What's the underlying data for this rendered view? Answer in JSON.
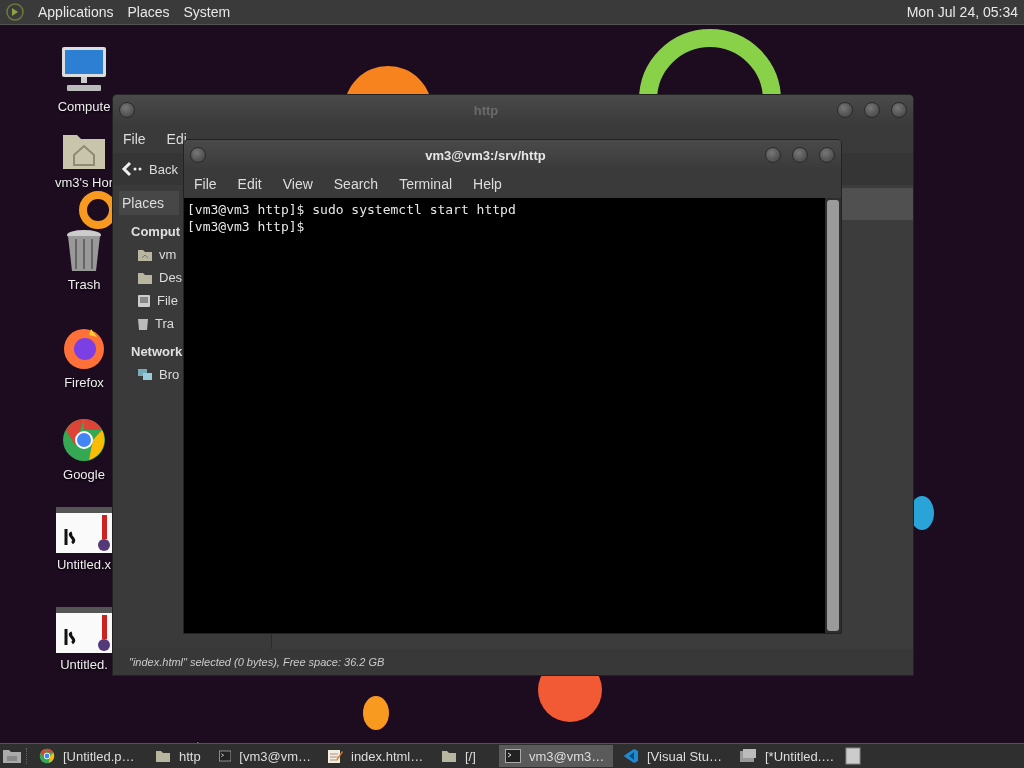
{
  "top_panel": {
    "menus": [
      "Applications",
      "Places",
      "System"
    ],
    "clock": "Mon Jul 24, 05:34"
  },
  "desktop_icons": [
    {
      "label": "Compute",
      "kind": "computer"
    },
    {
      "label": "vm3's Hor",
      "kind": "home"
    },
    {
      "label": "Trash",
      "kind": "trash"
    },
    {
      "label": "Firefox",
      "kind": "firefox"
    },
    {
      "label": "Google",
      "kind": "chrome"
    },
    {
      "label": "Untitled.x",
      "kind": "image"
    },
    {
      "label": "Untitled.",
      "kind": "image"
    }
  ],
  "file_manager": {
    "title": "http",
    "menu": [
      "File",
      "Edi"
    ],
    "back": "Back",
    "sidebar": {
      "header": "Places",
      "sections": [
        {
          "title": "Comput",
          "items": [
            {
              "label": "vm",
              "kind": "home"
            },
            {
              "label": "Des",
              "kind": "desktop"
            },
            {
              "label": "File",
              "kind": "drive"
            },
            {
              "label": "Tra",
              "kind": "trash"
            }
          ]
        },
        {
          "title": "Network",
          "items": [
            {
              "label": "Bro",
              "kind": "network"
            }
          ]
        }
      ]
    },
    "status": "\"index.html\" selected (0 bytes), Free space: 36.2 GB"
  },
  "terminal": {
    "title": "vm3@vm3:/srv/http",
    "menu": [
      "File",
      "Edit",
      "View",
      "Search",
      "Terminal",
      "Help"
    ],
    "lines": [
      "[vm3@vm3 http]$ sudo systemctl start httpd",
      "[vm3@vm3 http]$"
    ]
  },
  "taskbar": {
    "tasks": [
      {
        "label": "[Untitled.p…",
        "kind": "chrome",
        "selected": false
      },
      {
        "label": "http",
        "kind": "folder",
        "selected": false
      },
      {
        "label": "[vm3@vm…",
        "kind": "terminal",
        "selected": false
      },
      {
        "label": "index.html…",
        "kind": "editor",
        "selected": false
      },
      {
        "label": "[/]",
        "kind": "folder",
        "selected": false
      },
      {
        "label": "vm3@vm3…",
        "kind": "terminal",
        "selected": true
      },
      {
        "label": "[Visual Stu…",
        "kind": "vscode",
        "selected": false
      },
      {
        "label": "[*Untitled.…",
        "kind": "paint",
        "selected": false
      }
    ]
  }
}
